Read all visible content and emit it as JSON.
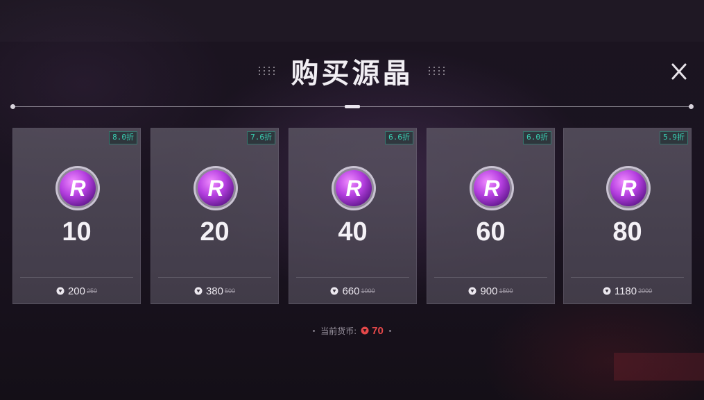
{
  "header": {
    "title": "购买源晶",
    "close_icon": "close-icon"
  },
  "packages": [
    {
      "amount": "10",
      "discount": "8.0折",
      "price": "200",
      "original_price": "250"
    },
    {
      "amount": "20",
      "discount": "7.6折",
      "price": "380",
      "original_price": "500"
    },
    {
      "amount": "40",
      "discount": "6.6折",
      "price": "660",
      "original_price": "1000"
    },
    {
      "amount": "60",
      "discount": "6.0折",
      "price": "900",
      "original_price": "1500"
    },
    {
      "amount": "80",
      "discount": "5.9折",
      "price": "1180",
      "original_price": "2000"
    }
  ],
  "balance": {
    "label": "当前货币:",
    "value": "70"
  },
  "colors": {
    "accent_teal": "#39d0b3",
    "coin_purple": "#b03cd8",
    "currency_red": "#e5484a"
  },
  "icons": {
    "crystal": "purple-r-coin-icon",
    "currency": "red-currency-icon"
  }
}
